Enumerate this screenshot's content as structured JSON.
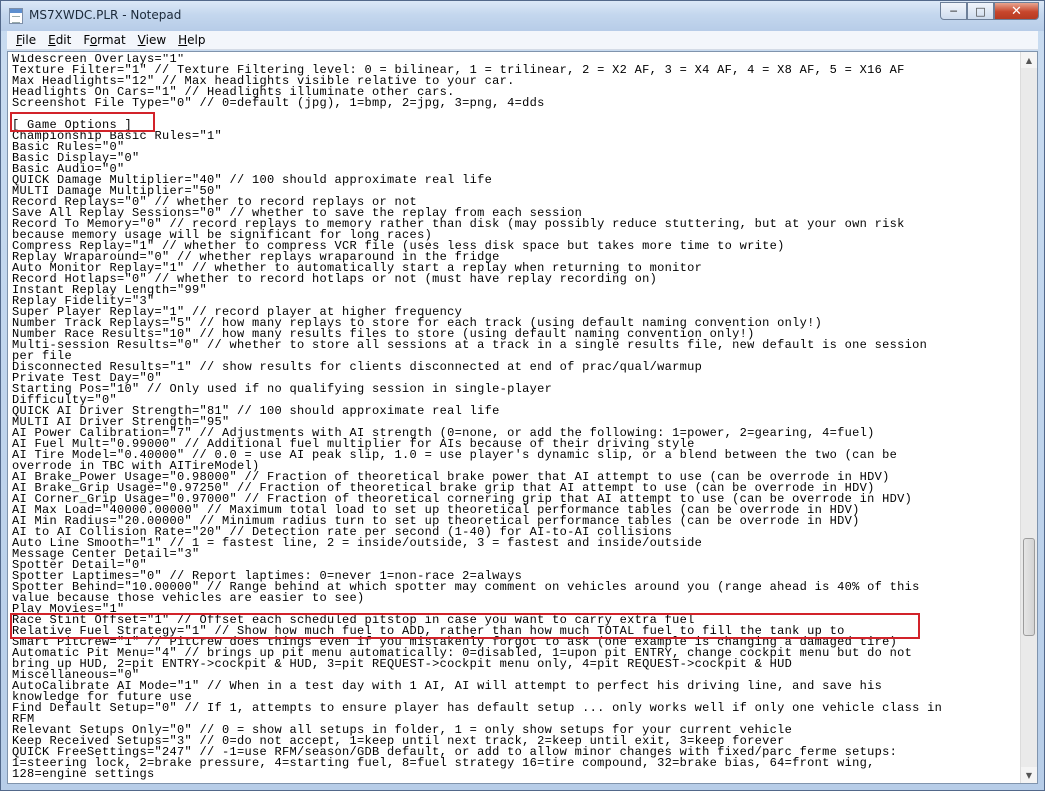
{
  "window": {
    "title": "MS7XWDC.PLR - Notepad",
    "minimize": "─",
    "maximize": "□",
    "close": "✕"
  },
  "menu": [
    {
      "label": "File",
      "key": "F",
      "rest": "ile"
    },
    {
      "label": "Edit",
      "key": "E",
      "rest": "dit"
    },
    {
      "label": "Format",
      "key": "o",
      "pre": "F",
      "rest": "rmat"
    },
    {
      "label": "View",
      "key": "V",
      "rest": "iew"
    },
    {
      "label": "Help",
      "key": "H",
      "rest": "elp"
    }
  ],
  "lines": [
    "Widescreen Overlays=\"1\"",
    "Texture Filter=\"1\" // Texture Filtering level: 0 = bilinear, 1 = trilinear, 2 = X2 AF, 3 = X4 AF, 4 = X8 AF, 5 = X16 AF",
    "Max Headlights=\"12\" // Max headlights visible relative to your car.",
    "Headlights On Cars=\"1\" // Headlights illuminate other cars.",
    "Screenshot File Type=\"0\" // 0=default (jpg), 1=bmp, 2=jpg, 3=png, 4=dds",
    "",
    "[ Game Options ]",
    "Championship Basic Rules=\"1\"",
    "Basic Rules=\"0\"",
    "Basic Display=\"0\"",
    "Basic Audio=\"0\"",
    "QUICK Damage Multiplier=\"40\" // 100 should approximate real life",
    "MULTI Damage Multiplier=\"50\"",
    "Record Replays=\"0\" // whether to record replays or not",
    "Save All Replay Sessions=\"0\" // whether to save the replay from each session",
    "Record To Memory=\"0\" // record replays to memory rather than disk (may possibly reduce stuttering, but at your own risk",
    "because memory usage will be significant for long races)",
    "Compress Replay=\"1\" // whether to compress VCR file (uses less disk space but takes more time to write)",
    "Replay Wraparound=\"0\" // whether replays wraparound in the fridge",
    "Auto Monitor Replay=\"1\" // whether to automatically start a replay when returning to monitor",
    "Record Hotlaps=\"0\" // whether to record hotlaps or not (must have replay recording on)",
    "Instant Replay Length=\"99\"",
    "Replay Fidelity=\"3\"",
    "Super Player Replay=\"1\" // record player at higher frequency",
    "Number Track Replays=\"5\" // how many replays to store for each track (using default naming convention only!)",
    "Number Race Results=\"10\" // how many results files to store (using default naming convention only!)",
    "Multi-session Results=\"0\" // whether to store all sessions at a track in a single results file, new default is one session",
    "per file",
    "Disconnected Results=\"1\" // show results for clients disconnected at end of prac/qual/warmup",
    "Private Test Day=\"0\"",
    "Starting Pos=\"10\" // Only used if no qualifying session in single-player",
    "Difficulty=\"0\"",
    "QUICK AI Driver Strength=\"81\" // 100 should approximate real life",
    "MULTI AI Driver Strength=\"95\"",
    "AI Power Calibration=\"7\" // Adjustments with AI strength (0=none, or add the following: 1=power, 2=gearing, 4=fuel)",
    "AI Fuel Mult=\"0.99000\" // Additional fuel multiplier for AIs because of their driving style",
    "AI Tire Model=\"0.40000\" // 0.0 = use AI peak slip, 1.0 = use player's dynamic slip, or a blend between the two (can be",
    "overrode in TBC with AITireModel)",
    "AI Brake_Power Usage=\"0.98000\" // Fraction of theoretical brake power that AI attempt to use (can be overrode in HDV)",
    "AI Brake_Grip Usage=\"0.97250\" // Fraction of theoretical brake grip that AI attempt to use (can be overrode in HDV)",
    "AI Corner_Grip Usage=\"0.97000\" // Fraction of theoretical cornering grip that AI attempt to use (can be overrode in HDV)",
    "AI Max Load=\"40000.00000\" // Maximum total load to set up theoretical performance tables (can be overrode in HDV)",
    "AI Min Radius=\"20.00000\" // Minimum radius turn to set up theoretical performance tables (can be overrode in HDV)",
    "AI to AI Collision Rate=\"20\" // Detection rate per second (1-40) for AI-to-AI collisions",
    "Auto Line Smooth=\"1\" // 1 = fastest line, 2 = inside/outside, 3 = fastest and inside/outside",
    "Message Center Detail=\"3\"",
    "Spotter Detail=\"0\"",
    "Spotter Laptimes=\"0\" // Report laptimes: 0=never 1=non-race 2=always",
    "Spotter Behind=\"10.00000\" // Range behind at which spotter may comment on vehicles around you (range ahead is 40% of this",
    "value because those vehicles are easier to see)",
    "Play Movies=\"1\"",
    "Race Stint Offset=\"1\" // Offset each scheduled pitstop in case you want to carry extra fuel",
    "Relative Fuel Strategy=\"1\" // Show how much fuel to ADD, rather than how much TOTAL fuel to fill the tank up to",
    "Smart PitCrew=\"1\" // PitCrew does things even if you mistakenly forgot to ask (one example is changing a damaged tire)",
    "Automatic Pit Menu=\"4\" // brings up pit menu automatically: 0=disabled, 1=upon pit ENTRY, change cockpit menu but do not",
    "bring up HUD, 2=pit ENTRY->cockpit & HUD, 3=pit REQUEST->cockpit menu only, 4=pit REQUEST->cockpit & HUD",
    "Miscellaneous=\"0\"",
    "AutoCalibrate AI Mode=\"1\" // When in a test day with 1 AI, AI will attempt to perfect his driving line, and save his",
    "knowledge for future use",
    "Find Default Setup=\"0\" // If 1, attempts to ensure player has default setup ... only works well if only one vehicle class in",
    "RFM",
    "Relevant Setups Only=\"0\" // 0 = show all setups in folder, 1 = only show setups for your current vehicle",
    "Keep Received Setups=\"3\" // 0=do not accept, 1=keep until next track, 2=keep until exit, 3=keep forever",
    "QUICK FreeSettings=\"247\" // -1=use RFM/season/GDB default, or add to allow minor changes with fixed/parc ferme setups:",
    "1=steering lock, 2=brake pressure, 4=starting fuel, 8=fuel strategy 16=tire compound, 32=brake bias, 64=front wing,",
    "128=engine settings"
  ]
}
